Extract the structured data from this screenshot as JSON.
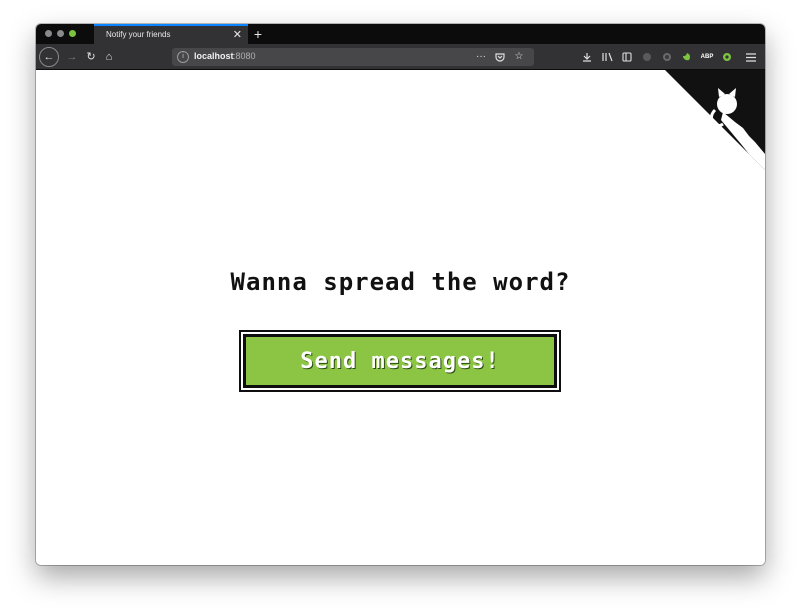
{
  "browser": {
    "tab_title": "Notify your friends",
    "tab_close": "✕",
    "new_tab": "+",
    "url_host": "localhost",
    "url_port": ":8080",
    "url_more": "···",
    "nav": {
      "back": "←",
      "forward": "→",
      "reload": "↻",
      "home": "⌂"
    },
    "ext_label": "ABP"
  },
  "page": {
    "headline": "Wanna spread the word?",
    "button_label": "Send messages!"
  },
  "colors": {
    "button_bg": "#8cc543",
    "tab_accent": "#0a84ff",
    "corner": "#111111"
  },
  "icons": {
    "corner": "github-octocat-icon"
  }
}
